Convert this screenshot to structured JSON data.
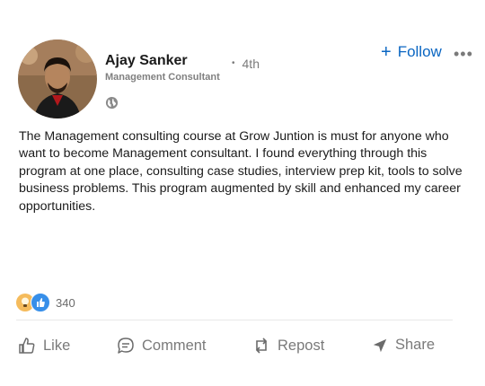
{
  "author": {
    "name": "Ajay Sanker",
    "degree": "4th",
    "headline": "Management Consultant"
  },
  "actions_top": {
    "follow_label": "Follow",
    "follow_icon": "plus-icon",
    "more_icon": "more-options-icon"
  },
  "post": {
    "text": "The Management consulting course at Grow Juntion is must for anyone who want to become Management consultant. I found everything through this program at one place, consulting case studies, interview prep kit, tools to solve business problems. This program augmented by skill and enhanced my career opportunities."
  },
  "reactions": {
    "count": "340",
    "icons": [
      "insightful-icon",
      "like-icon"
    ]
  },
  "action_bar": {
    "like": "Like",
    "comment": "Comment",
    "repost": "Repost",
    "share": "Share"
  },
  "colors": {
    "accent": "#0a66c2",
    "muted": "#7a7a7a",
    "like_blue": "#378fe9",
    "insight_yellow": "#f5bb5c"
  }
}
